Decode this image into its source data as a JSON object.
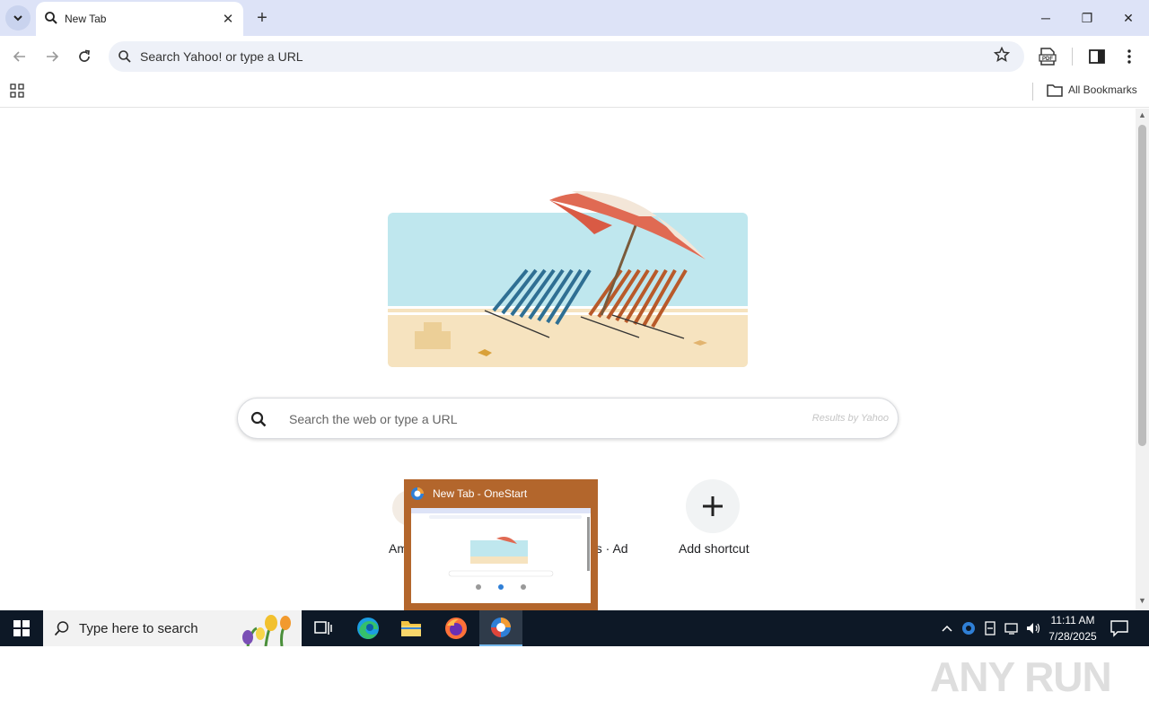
{
  "browser": {
    "tab": {
      "title": "New Tab",
      "close_glyph": "✕"
    },
    "new_tab_glyph": "+",
    "window_controls": {
      "minimize": "─",
      "restore": "❐",
      "close": "✕"
    },
    "omnibox": {
      "placeholder": "Search Yahoo! or type a URL"
    },
    "bookmarks": {
      "all_bookmarks_label": "All Bookmarks"
    }
  },
  "page": {
    "search": {
      "placeholder": "Search the web or type a URL",
      "provider_note": "Results by Yahoo"
    },
    "shortcuts": [
      {
        "label": "Am"
      },
      {
        "label": "ns · Ad"
      },
      {
        "label": "Add shortcut"
      }
    ]
  },
  "preview": {
    "title": "New Tab - OneStart"
  },
  "watermark": {
    "text": "ANY RUN"
  },
  "taskbar": {
    "search_placeholder": "Type here to search",
    "clock": {
      "time": "11:11 AM",
      "date": "7/28/2025"
    }
  }
}
